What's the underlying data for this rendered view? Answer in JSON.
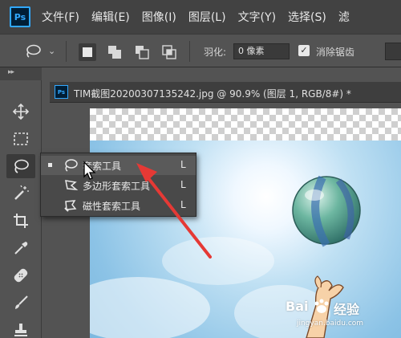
{
  "app": {
    "logo_text": "Ps",
    "menu": [
      "文件(F)",
      "编辑(E)",
      "图像(I)",
      "图层(L)",
      "文字(Y)",
      "选择(S)",
      "滤"
    ]
  },
  "options_bar": {
    "feather_label": "羽化:",
    "feather_value": "0 像素",
    "antialias_checked": true,
    "antialias_label": "消除锯齿"
  },
  "document": {
    "icon_text": "Ps",
    "title": "TIM截图20200307135242.jpg @ 90.9% (图层 1, RGB/8#) *"
  },
  "tool_flyout": {
    "items": [
      {
        "label": "套索工具",
        "shortcut": "L",
        "selected": true
      },
      {
        "label": "多边形套索工具",
        "shortcut": "L",
        "selected": false
      },
      {
        "label": "磁性套索工具",
        "shortcut": "L",
        "selected": false
      }
    ]
  },
  "toolbar": {
    "collapse_glyph": "▸▸",
    "tools": [
      "move-icon",
      "marquee-icon",
      "lasso-icon",
      "magic-wand-icon",
      "crop-icon",
      "eyedropper-icon",
      "healing-brush-icon",
      "brush-icon",
      "clone-stamp-icon"
    ],
    "active_tool": "lasso-icon"
  },
  "watermark": {
    "brand": "Bai",
    "brand_cn": "经验",
    "url": "jingyan.baidu.com"
  },
  "colors": {
    "menubar_bg": "#424242",
    "panel_bg": "#535353",
    "ps_blue": "#31a8ff",
    "annotation_red": "#e53935"
  }
}
